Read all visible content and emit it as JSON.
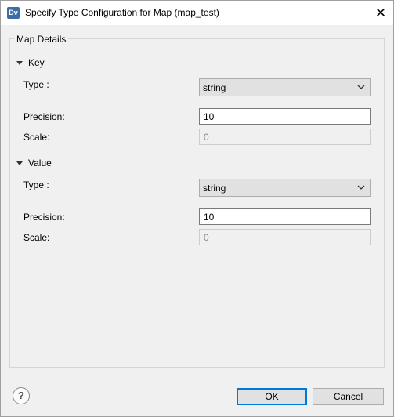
{
  "window": {
    "icon_text": "Dv",
    "title": "Specify Type Configuration for Map (map_test)",
    "close_glyph": "✕"
  },
  "group": {
    "legend": "Map Details"
  },
  "key": {
    "header": "Key",
    "type_label": "Type :",
    "type_value": "string",
    "precision_label": "Precision:",
    "precision_value": "10",
    "scale_label": "Scale:",
    "scale_value": "0"
  },
  "value": {
    "header": "Value",
    "type_label": "Type :",
    "type_value": "string",
    "precision_label": "Precision:",
    "precision_value": "10",
    "scale_label": "Scale:",
    "scale_value": "0"
  },
  "footer": {
    "help_glyph": "?",
    "ok_label": "OK",
    "cancel_label": "Cancel"
  },
  "icons": {
    "app": "dv-app-icon",
    "close": "close-icon",
    "collapse": "triangle-down-icon",
    "dropdown": "chevron-down-icon",
    "help": "help-icon"
  },
  "colors": {
    "accent": "#0078d7",
    "background": "#f0f0f0",
    "titlebar": "#ffffff"
  }
}
